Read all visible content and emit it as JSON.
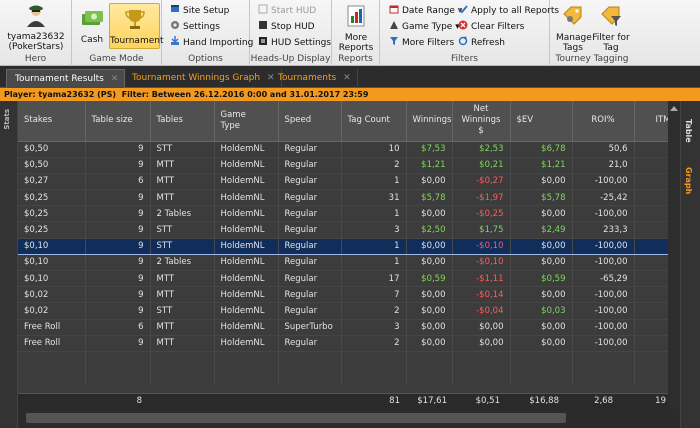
{
  "ribbon": {
    "hero": {
      "name": "tyama23632 (PokerStars)",
      "label": "Hero"
    },
    "game_mode": {
      "cash": "Cash",
      "tournament": "Tournament",
      "label": "Game Mode"
    },
    "options": {
      "site_setup": "Site Setup",
      "settings": "Settings",
      "hand_importing": "Hand Importing",
      "label": "Options"
    },
    "hud": {
      "start": "Start HUD",
      "stop": "Stop HUD",
      "settings": "HUD Settings",
      "label": "Heads-Up Display"
    },
    "reports": {
      "more": "More Reports",
      "label": "Reports"
    },
    "filters": {
      "date_range": "Date Range",
      "game_type": "Game Type",
      "more_filters": "More Filters",
      "apply_all": "Apply to all Reports",
      "clear": "Clear Filters",
      "refresh": "Refresh",
      "label": "Filters"
    },
    "tagging": {
      "manage": "Manage Tags",
      "filter_tag": "Filter for Tag",
      "label": "Tourney Tagging"
    }
  },
  "tabs": [
    {
      "label": "Tournament Results"
    },
    {
      "label": "Tournament Winnings Graph"
    },
    {
      "label": "Tournaments"
    }
  ],
  "filterbar": {
    "player": "Player: tyama23632 (PS)",
    "filter": "Filter: Between 26.12.2016 0:00 and 31.01.2017 23:59"
  },
  "side": {
    "stats": "Stats",
    "table": "Table",
    "graph": "Graph"
  },
  "columns": [
    "Stakes",
    "Table size",
    "Tables",
    "Game Type",
    "Speed",
    "Tag Count",
    "Winnings",
    "Net Winnings $",
    "$EV",
    "ROI%",
    "ITM%"
  ],
  "rows": [
    [
      "$0,50",
      "9",
      "STT",
      "HoldemNL",
      "Regular",
      "10",
      "$7,53",
      "$2,53",
      "$6,78",
      "50,6",
      "50"
    ],
    [
      "$0,50",
      "9",
      "MTT",
      "HoldemNL",
      "Regular",
      "2",
      "$1,21",
      "$0,21",
      "$1,21",
      "21,0",
      "50"
    ],
    [
      "$0,27",
      "6",
      "MTT",
      "HoldemNL",
      "Regular",
      "1",
      "$0,00",
      "-$0,27",
      "$0,00",
      "-100,00",
      "0"
    ],
    [
      "$0,25",
      "9",
      "MTT",
      "HoldemNL",
      "Regular",
      "31",
      "$5,78",
      "-$1,97",
      "$5,78",
      "-25,42",
      "22"
    ],
    [
      "$0,25",
      "9",
      "2 Tables",
      "HoldemNL",
      "Regular",
      "1",
      "$0,00",
      "-$0,25",
      "$0,00",
      "-100,00",
      "0"
    ],
    [
      "$0,25",
      "9",
      "STT",
      "HoldemNL",
      "Regular",
      "3",
      "$2,50",
      "$1,75",
      "$2,49",
      "233,3",
      "33"
    ],
    [
      "$0,10",
      "9",
      "STT",
      "HoldemNL",
      "Regular",
      "1",
      "$0,00",
      "-$0,10",
      "$0,00",
      "-100,00",
      "0"
    ],
    [
      "$0,10",
      "9",
      "2 Tables",
      "HoldemNL",
      "Regular",
      "1",
      "$0,00",
      "-$0,10",
      "$0,00",
      "-100,00",
      "0"
    ],
    [
      "$0,10",
      "9",
      "MTT",
      "HoldemNL",
      "Regular",
      "17",
      "$0,59",
      "-$1,11",
      "$0,59",
      "-65,29",
      "11"
    ],
    [
      "$0,02",
      "9",
      "MTT",
      "HoldemNL",
      "Regular",
      "7",
      "$0,00",
      "-$0,14",
      "$0,00",
      "-100,00",
      "0"
    ],
    [
      "$0,02",
      "9",
      "STT",
      "HoldemNL",
      "Regular",
      "2",
      "$0,00",
      "-$0,04",
      "$0,03",
      "-100,00",
      "0"
    ],
    [
      "Free Roll",
      "6",
      "MTT",
      "HoldemNL",
      "SuperTurbo",
      "3",
      "$0,00",
      "$0,00",
      "$0,00",
      "-100,00",
      "0"
    ],
    [
      "Free Roll",
      "9",
      "MTT",
      "HoldemNL",
      "Regular",
      "2",
      "$0,00",
      "$0,00",
      "$0,00",
      "-100,00",
      "0"
    ]
  ],
  "totals": {
    "table_size": "8",
    "tag_count": "81",
    "winnings": "$17,61",
    "net": "$0,51",
    "ev": "$16,88",
    "roi": "2,68",
    "itm": "19"
  },
  "colors": {
    "accent": "#f39a1e",
    "positive": "#7ed957",
    "negative": "#ff5b5b",
    "selected_row": "#112d5a"
  }
}
